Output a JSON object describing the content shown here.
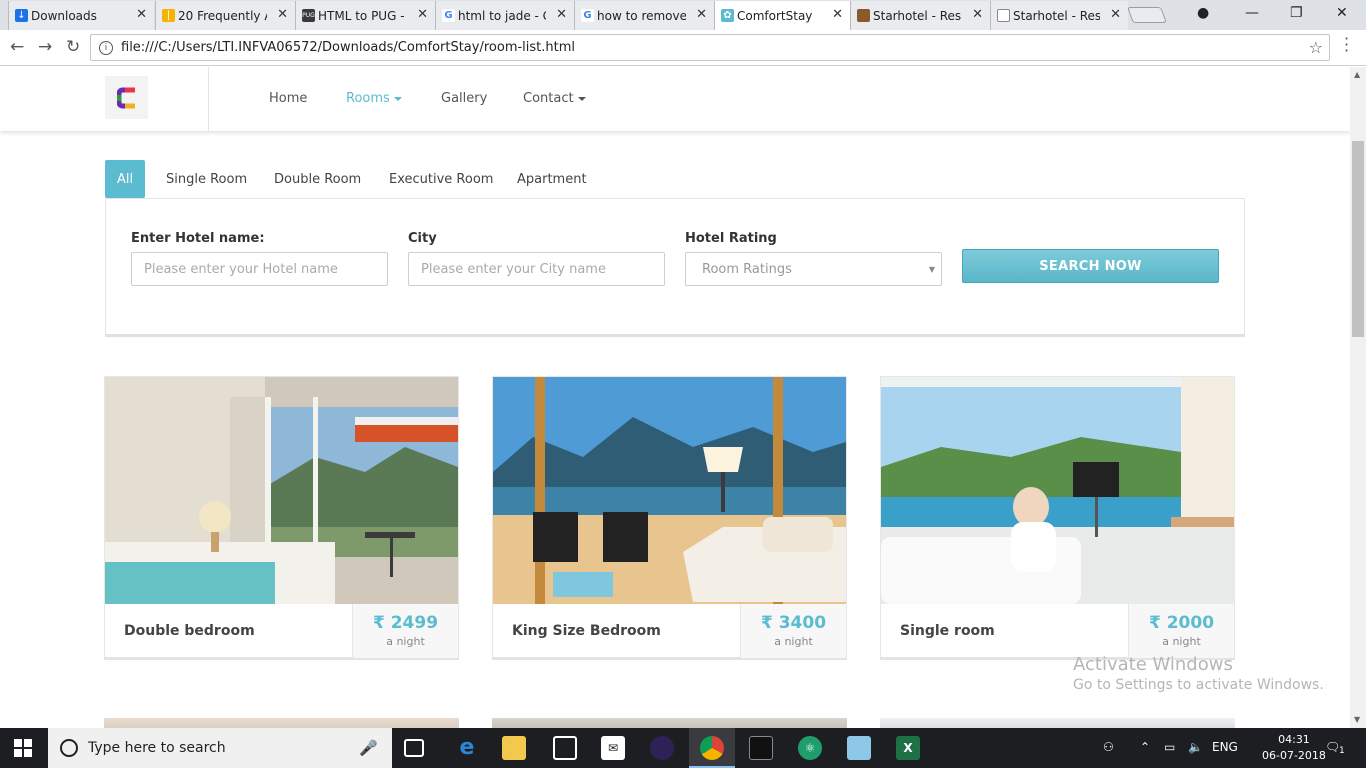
{
  "browser": {
    "tabs": [
      {
        "title": "Downloads",
        "icon": "download-icon",
        "color": "#1a73e8"
      },
      {
        "title": "20 Frequently A",
        "icon": "bars-icon",
        "color": "#f4b400"
      },
      {
        "title": "HTML to PUG -",
        "icon": "pug-icon",
        "color": "#3a3a3a"
      },
      {
        "title": "html to jade - G",
        "icon": "google-icon",
        "color": "#4285f4"
      },
      {
        "title": "how to remove",
        "icon": "google-icon",
        "color": "#4285f4"
      },
      {
        "title": "ComfortStay",
        "icon": "star-icon",
        "color": "#5bbcd0"
      },
      {
        "title": "Starhotel - Resp",
        "icon": "hotel-icon",
        "color": "#8a5a2b"
      },
      {
        "title": "Starhotel - Resp",
        "icon": "page-icon",
        "color": "#888888"
      }
    ],
    "url": "file:///C:/Users/LTI.INFVA06572/Downloads/ComfortStay/room-list.html"
  },
  "site": {
    "nav": {
      "home": "Home",
      "rooms": "Rooms",
      "gallery": "Gallery",
      "contact": "Contact"
    },
    "filters": [
      "All",
      "Single Room",
      "Double Room",
      "Executive Room",
      "Apartment"
    ],
    "search": {
      "hotel_label": "Enter Hotel name:",
      "hotel_placeholder": "Please enter your Hotel name",
      "city_label": "City",
      "city_placeholder": "Please enter your City name",
      "rating_label": "Hotel Rating",
      "rating_value": "Room Ratings",
      "button": "SEARCH NOW"
    },
    "rooms": [
      {
        "name": "Double bedroom",
        "price": "₹ 2499",
        "per": "a night"
      },
      {
        "name": "King Size Bedroom",
        "price": "₹ 3400",
        "per": "a night"
      },
      {
        "name": "Single room",
        "price": "₹ 2000",
        "per": "a night"
      }
    ],
    "accent_color": "#5bbcd0"
  },
  "os": {
    "watermark_title": "Activate Windows",
    "watermark_sub": "Go to Settings to activate Windows.",
    "search_placeholder": "Type here to search",
    "language": "ENG",
    "time": "04:31",
    "date": "06-07-2018",
    "notification_count": "1"
  }
}
